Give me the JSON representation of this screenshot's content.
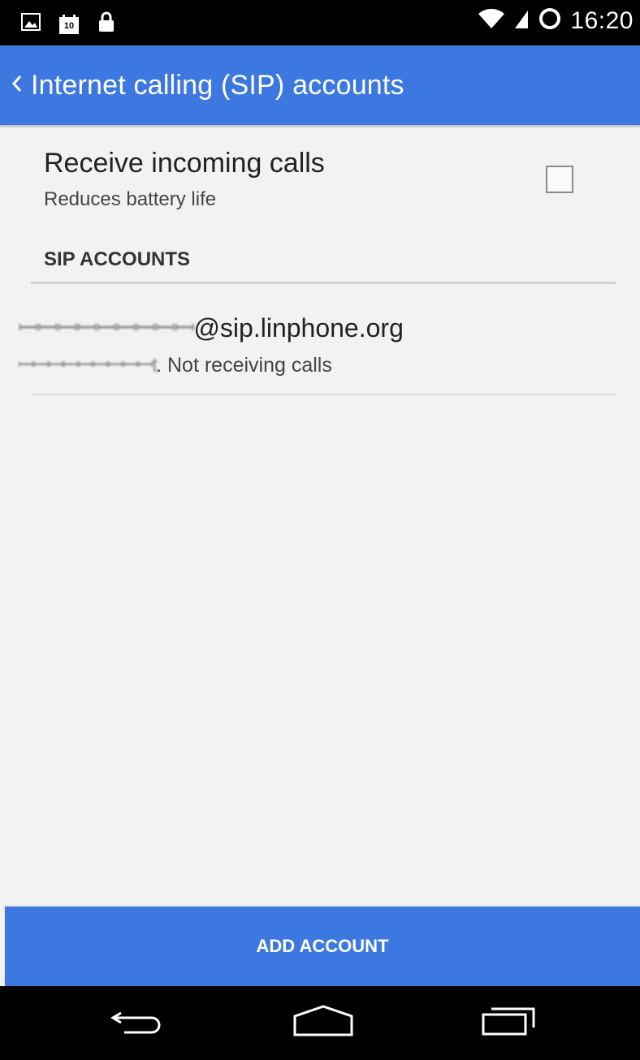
{
  "status_bar": {
    "time": "16:20",
    "left_icons": [
      "gallery-icon",
      "calendar-icon",
      "lock-icon"
    ],
    "calendar_day": "10",
    "right_icons": [
      "wifi-icon",
      "signal-icon",
      "sync-icon"
    ]
  },
  "app_bar": {
    "title": "Internet calling (SIP) accounts",
    "back_icon": "chevron-left-icon",
    "color": "#3c78e0"
  },
  "receive_calls": {
    "title": "Receive incoming calls",
    "summary": "Reduces battery life",
    "checked": false
  },
  "sip_section": {
    "header": "SIP ACCOUNTS",
    "accounts": [
      {
        "name_prefix": "ꟷꟷꟷꟷꟷꟷꟷꟷꟷ",
        "name_domain": "@sip.linphone.org",
        "status_prefix": "ꟷꟷꟷꟷꟷꟷꟷꟷꟷt",
        "status_suffix": ". Not receiving calls"
      }
    ]
  },
  "footer": {
    "add_button": "ADD ACCOUNT"
  },
  "nav_bar": {
    "icons": [
      "back-icon",
      "home-icon",
      "recents-icon"
    ]
  }
}
